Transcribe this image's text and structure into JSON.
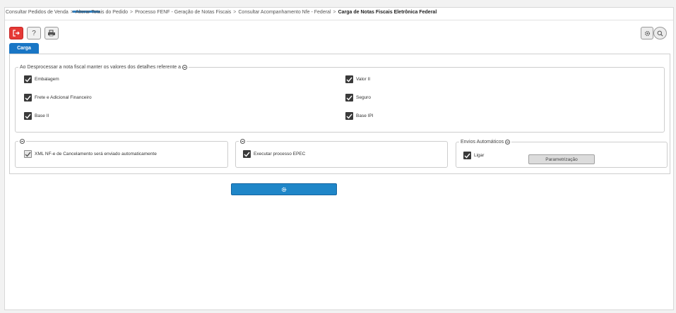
{
  "breadcrumb": {
    "items": [
      "Consultar Pedidos de Venda",
      "Alterar Totais do Pedido",
      "Processo FENF - Geração de Notas Fiscais",
      "Consultar Acompanhamento Nfe - Federal",
      "Carga de Notas Fiscais Eletrônica Federal"
    ],
    "separator": ">"
  },
  "toolbar": {
    "exit_icon": "exit-icon",
    "help_label": "?",
    "print_icon": "printer-icon",
    "settings_icon": "gear-icon",
    "search_icon": "search-icon"
  },
  "tabs": [
    {
      "label": "Carga",
      "active": true
    }
  ],
  "group_detalhes": {
    "legend": "Ao Desprocessar a nota fiscal manter os valores dos detalhes referente a",
    "left_items": [
      {
        "label": "Embalagem",
        "checked": true
      },
      {
        "label": "Frete e Adicional Financeiro",
        "checked": true
      },
      {
        "label": "Base II",
        "checked": true
      }
    ],
    "right_items": [
      {
        "label": "Valor II",
        "checked": true
      },
      {
        "label": "Seguro",
        "checked": true
      },
      {
        "label": "Base IPI",
        "checked": true
      }
    ]
  },
  "group_xml": {
    "legend": "",
    "item": {
      "label": "XML NF-e de Cancelamento será enviado automaticamente",
      "checked": true
    }
  },
  "group_epec": {
    "legend": "",
    "item": {
      "label": "Executar processo EPEC",
      "checked": true
    }
  },
  "group_envios": {
    "legend": "Envios Automáticos",
    "item": {
      "label": "Ligar",
      "checked": true
    },
    "button_label": "Parametrização"
  },
  "run_button_icon": "gear-icon",
  "colors": {
    "accent": "#1976c5",
    "exit": "#e53935",
    "run": "#1f86c8"
  }
}
